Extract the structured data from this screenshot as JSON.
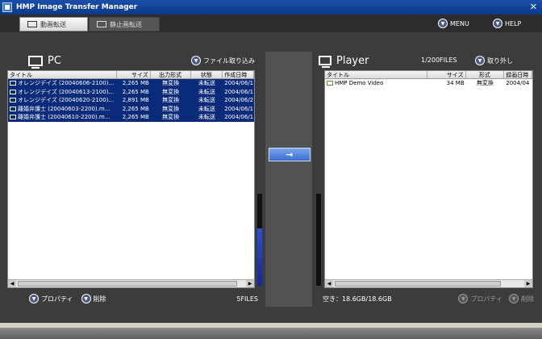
{
  "window": {
    "title": "HMP Image Transfer Manager",
    "close_glyph": "✕"
  },
  "tabs": [
    {
      "label": "動画転送",
      "active": true
    },
    {
      "label": "静止画転送",
      "active": false
    }
  ],
  "toolbar": {
    "menu_label": "MENU",
    "help_label": "HELP"
  },
  "pc": {
    "title": "PC",
    "import_label": "ファイル取り込み",
    "columns": [
      "タイトル",
      "サイズ",
      "出力形式",
      "状態",
      "作成日時"
    ],
    "rows": [
      {
        "title": "オレンジデイズ (20040606-2100)...",
        "size": "2,265 MB",
        "format": "無変換",
        "status": "未転送",
        "date": "2004/06/1"
      },
      {
        "title": "オレンジデイズ (20040613-2100)...",
        "size": "2,265 MB",
        "format": "無変換",
        "status": "未転送",
        "date": "2004/06/1"
      },
      {
        "title": "オレンジデイズ (20040620-2100)...",
        "size": "2,891 MB",
        "format": "無変換",
        "status": "未転送",
        "date": "2004/06/2"
      },
      {
        "title": "離婚弁護士 (20040603-2200).m...",
        "size": "2,265 MB",
        "format": "無変換",
        "status": "未転送",
        "date": "2004/06/1"
      },
      {
        "title": "離婚弁護士 (20040610-2200).m...",
        "size": "2,265 MB",
        "format": "無変換",
        "status": "未転送",
        "date": "2004/06/1"
      }
    ],
    "properties_label": "プロパティ",
    "delete_label": "削除",
    "file_count": "5FILES"
  },
  "player": {
    "title": "Player",
    "file_count": "1/200FILES",
    "remove_label": "取り外し",
    "columns": [
      "タイトル",
      "サイズ",
      "形式",
      "録画日時"
    ],
    "rows": [
      {
        "title": "HMP Demo Video",
        "size": "34 MB",
        "format": "無変換",
        "date": "2004/04"
      }
    ],
    "free_space": "空き：18.6GB/18.6GB",
    "properties_label": "プロパティ",
    "delete_label": "削除"
  },
  "transfer": {
    "arrow": "→"
  },
  "pc_meter_fraction": 0.62,
  "player_meter_fraction": 0.0,
  "colors": {
    "selection": "#0a2a7a",
    "accent": "#3b6cd0",
    "titlebar": "#1a4ea8"
  }
}
